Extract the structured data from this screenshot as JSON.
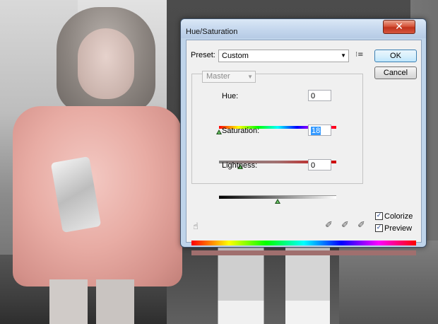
{
  "window": {
    "title": "Hue/Saturation",
    "close_glyph": "✕"
  },
  "preset": {
    "label": "Preset:",
    "value": "Custom",
    "menu_icon": "preset-options-icon",
    "menu_glyph": "⁝≡"
  },
  "buttons": {
    "ok": "OK",
    "cancel": "Cancel"
  },
  "edit": {
    "value": "Master"
  },
  "hue": {
    "label": "Hue:",
    "value": "0",
    "slider_fraction": 0.0
  },
  "saturation": {
    "label": "Saturation:",
    "value": "18",
    "slider_fraction": 0.18
  },
  "lightness": {
    "label": "Lightness:",
    "value": "0",
    "slider_fraction": 0.5
  },
  "tools": {
    "hand_glyph": "☝",
    "eyedropper_glyph": "✐",
    "eyedropper_plus_glyph": "✐",
    "eyedropper_minus_glyph": "✐"
  },
  "options": {
    "colorize_label": "Colorize",
    "colorize_checked": true,
    "preview_label": "Preview",
    "preview_checked": true,
    "check_glyph": "✓"
  },
  "colors": {
    "colorized_bar": "#a06f6e",
    "ok_border": "#3c7fb1",
    "close_red": "#c0331c"
  }
}
